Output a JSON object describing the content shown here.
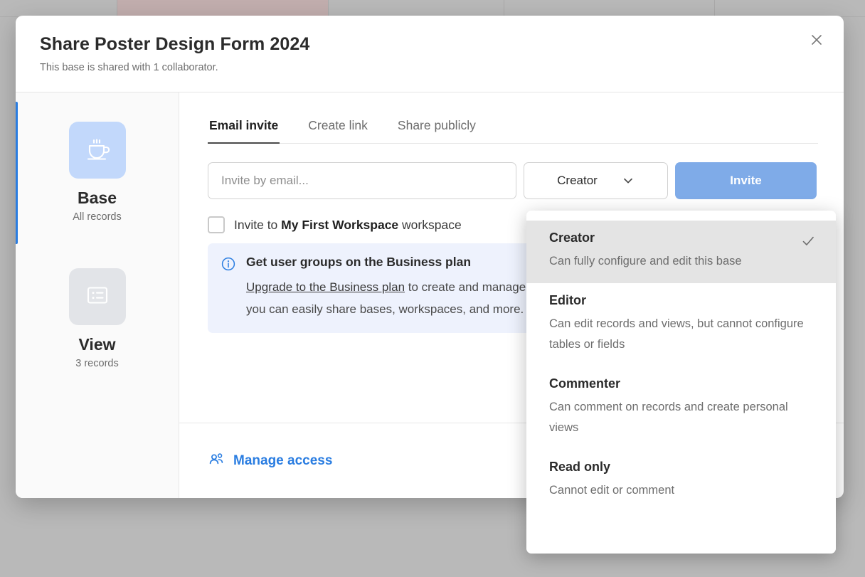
{
  "modal": {
    "title": "Share Poster Design Form 2024",
    "subtitle": "This base is shared with 1 collaborator.",
    "close_icon": "close-icon"
  },
  "sidebar": {
    "entries": [
      {
        "icon": "coffee-cup-icon",
        "label": "Base",
        "sub": "All records"
      },
      {
        "icon": "list-view-icon",
        "label": "View",
        "sub": "3 records"
      }
    ]
  },
  "tabs": [
    {
      "label": "Email invite",
      "active": true
    },
    {
      "label": "Create link",
      "active": false
    },
    {
      "label": "Share publicly",
      "active": false
    }
  ],
  "invite": {
    "email_placeholder": "Invite by email...",
    "email_value": "",
    "role_selected": "Creator",
    "chevron_icon": "chevron-down-icon",
    "button_label": "Invite"
  },
  "workspace_checkbox": {
    "checked": false,
    "text_before": "Invite to ",
    "workspace_name": "My First Workspace",
    "text_after": " workspace"
  },
  "banner": {
    "icon": "info-circle-icon",
    "title": "Get user groups on the Business plan",
    "link_text": "Upgrade to the Business plan",
    "line1_rest": " to create and manage user groups so",
    "line2": "you can easily share bases, workspaces, and more."
  },
  "footer": {
    "manage_access_label": "Manage access",
    "manage_access_icon": "users-group-icon"
  },
  "role_menu": {
    "options": [
      {
        "name": "Creator",
        "description": "Can fully configure and edit this base",
        "selected": true,
        "check_icon": "check-icon"
      },
      {
        "name": "Editor",
        "description": "Can edit records and views, but cannot configure tables or fields",
        "selected": false
      },
      {
        "name": "Commenter",
        "description": "Can comment on records and create personal views",
        "selected": false
      },
      {
        "name": "Read only",
        "description": "Cannot edit or comment",
        "selected": false
      }
    ]
  },
  "colors": {
    "accent_blue": "#2a7de1",
    "invite_button": "#7fabe8",
    "banner_bg": "#eef2fd",
    "base_tile": "#c2d8fb",
    "view_tile": "#e2e4e8",
    "backdrop": "#b9b9b9"
  }
}
